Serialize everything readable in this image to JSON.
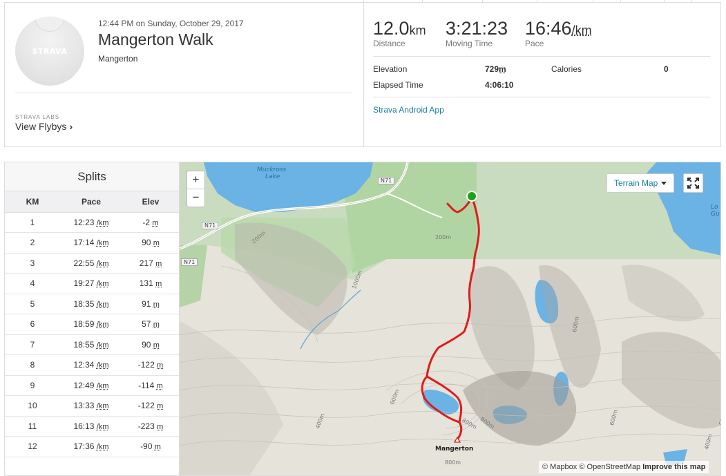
{
  "activity": {
    "datetime": "12:44 PM on Sunday, October 29, 2017",
    "title": "Mangerton Walk",
    "location": "Mangerton",
    "avatar_brand": "STRAVA",
    "labs_label": "STRAVA LABS",
    "flyby_label": "View Flybys"
  },
  "stats": {
    "distance": {
      "value": "12.0",
      "unit": "km",
      "label": "Distance"
    },
    "moving_time": {
      "value": "3:21:23",
      "label": "Moving Time"
    },
    "pace": {
      "value": "16:46",
      "unit": "/km",
      "label": "Pace"
    },
    "elevation": {
      "label": "Elevation",
      "value": "729",
      "unit": "m"
    },
    "calories": {
      "label": "Calories",
      "value": "0"
    },
    "elapsed": {
      "label": "Elapsed Time",
      "value": "4:06:10"
    },
    "device": "Strava Android App"
  },
  "splits": {
    "title": "Splits",
    "headers": {
      "km": "KM",
      "pace": "Pace",
      "elev": "Elev"
    },
    "pace_unit": "/km",
    "elev_unit": "m",
    "rows": [
      {
        "km": "1",
        "pace": "12:23",
        "elev": "-2"
      },
      {
        "km": "2",
        "pace": "17:14",
        "elev": "90"
      },
      {
        "km": "3",
        "pace": "22:55",
        "elev": "217"
      },
      {
        "km": "4",
        "pace": "19:27",
        "elev": "131"
      },
      {
        "km": "5",
        "pace": "18:35",
        "elev": "91"
      },
      {
        "km": "6",
        "pace": "18:59",
        "elev": "57"
      },
      {
        "km": "7",
        "pace": "18:55",
        "elev": "90"
      },
      {
        "km": "8",
        "pace": "12:34",
        "elev": "-122"
      },
      {
        "km": "9",
        "pace": "12:49",
        "elev": "-114"
      },
      {
        "km": "10",
        "pace": "13:33",
        "elev": "-122"
      },
      {
        "km": "11",
        "pace": "16:13",
        "elev": "-223"
      },
      {
        "km": "12",
        "pace": "17:36",
        "elev": "-90"
      }
    ]
  },
  "map": {
    "zoom_in": "+",
    "zoom_out": "−",
    "terrain_label": "Terrain Map",
    "attribution": {
      "mapbox": "© Mapbox",
      "osm": "© OpenStreetMap",
      "improve": "Improve this map"
    },
    "labels": {
      "muckross": "Muckross",
      "lake": "Lake",
      "n71_a": "N71",
      "n71_b": "N71",
      "n71_c": "N71",
      "c200a": "200m",
      "c200b": "200m",
      "c400": "400m",
      "c600a": "600m",
      "c600b": "600m",
      "c600c": "600m",
      "c600d": "600m",
      "c800a": "800m",
      "c800b": "800m",
      "c800c": "800m",
      "c1000": "1000m",
      "c400b": "400m",
      "summit": "Mangerton",
      "edge_lo": "Lo",
      "edge_gu": "Gu"
    },
    "colors": {
      "route": "#e01b1b",
      "start": "#19a319",
      "water": "#6ab3e4",
      "forest": "#a9d39b"
    }
  }
}
